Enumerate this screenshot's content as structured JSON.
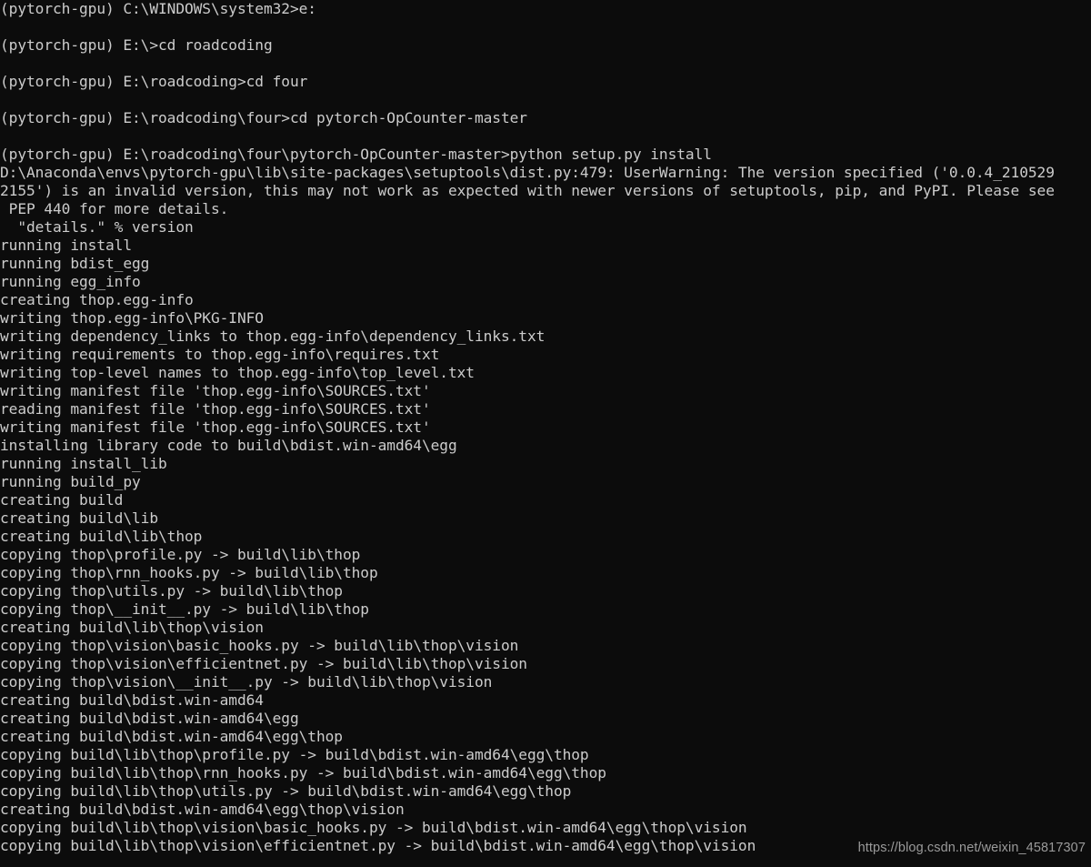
{
  "window": {
    "kind": "windows-command-prompt",
    "background_color": "#0c0c0c",
    "text_color": "#cccccc",
    "watermark_color": "#9a9a9a"
  },
  "terminal": {
    "prompt_env": "(pytorch-gpu)",
    "lines": [
      "(pytorch-gpu) C:\\WINDOWS\\system32>e:",
      "",
      "(pytorch-gpu) E:\\>cd roadcoding",
      "",
      "(pytorch-gpu) E:\\roadcoding>cd four",
      "",
      "(pytorch-gpu) E:\\roadcoding\\four>cd pytorch-OpCounter-master",
      "",
      "(pytorch-gpu) E:\\roadcoding\\four\\pytorch-OpCounter-master>python setup.py install",
      "D:\\Anaconda\\envs\\pytorch-gpu\\lib\\site-packages\\setuptools\\dist.py:479: UserWarning: The version specified ('0.0.4_210529",
      "2155') is an invalid version, this may not work as expected with newer versions of setuptools, pip, and PyPI. Please see",
      " PEP 440 for more details.",
      "  \"details.\" % version",
      "running install",
      "running bdist_egg",
      "running egg_info",
      "creating thop.egg-info",
      "writing thop.egg-info\\PKG-INFO",
      "writing dependency_links to thop.egg-info\\dependency_links.txt",
      "writing requirements to thop.egg-info\\requires.txt",
      "writing top-level names to thop.egg-info\\top_level.txt",
      "writing manifest file 'thop.egg-info\\SOURCES.txt'",
      "reading manifest file 'thop.egg-info\\SOURCES.txt'",
      "writing manifest file 'thop.egg-info\\SOURCES.txt'",
      "installing library code to build\\bdist.win-amd64\\egg",
      "running install_lib",
      "running build_py",
      "creating build",
      "creating build\\lib",
      "creating build\\lib\\thop",
      "copying thop\\profile.py -> build\\lib\\thop",
      "copying thop\\rnn_hooks.py -> build\\lib\\thop",
      "copying thop\\utils.py -> build\\lib\\thop",
      "copying thop\\__init__.py -> build\\lib\\thop",
      "creating build\\lib\\thop\\vision",
      "copying thop\\vision\\basic_hooks.py -> build\\lib\\thop\\vision",
      "copying thop\\vision\\efficientnet.py -> build\\lib\\thop\\vision",
      "copying thop\\vision\\__init__.py -> build\\lib\\thop\\vision",
      "creating build\\bdist.win-amd64",
      "creating build\\bdist.win-amd64\\egg",
      "creating build\\bdist.win-amd64\\egg\\thop",
      "copying build\\lib\\thop\\profile.py -> build\\bdist.win-amd64\\egg\\thop",
      "copying build\\lib\\thop\\rnn_hooks.py -> build\\bdist.win-amd64\\egg\\thop",
      "copying build\\lib\\thop\\utils.py -> build\\bdist.win-amd64\\egg\\thop",
      "creating build\\bdist.win-amd64\\egg\\thop\\vision",
      "copying build\\lib\\thop\\vision\\basic_hooks.py -> build\\bdist.win-amd64\\egg\\thop\\vision",
      "copying build\\lib\\thop\\vision\\efficientnet.py -> build\\bdist.win-amd64\\egg\\thop\\vision"
    ]
  },
  "watermark": {
    "text": "https://blog.csdn.net/weixin_45817307"
  }
}
